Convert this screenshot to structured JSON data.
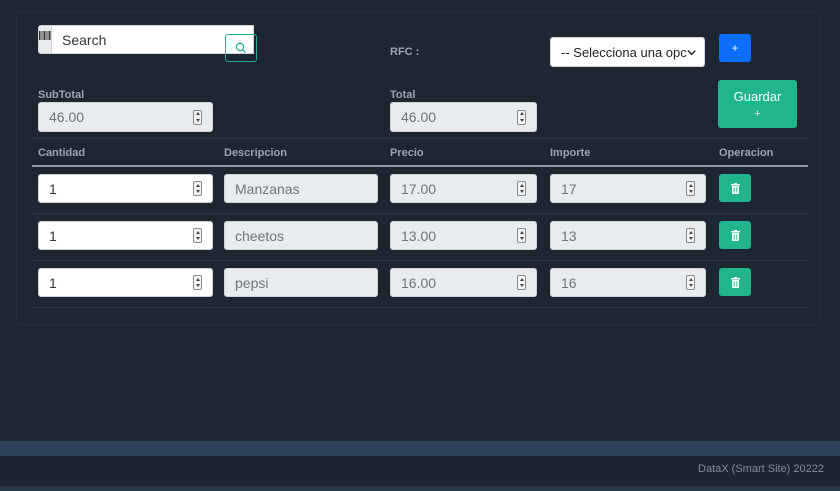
{
  "search": {
    "placeholder": "Search"
  },
  "rfc": {
    "label": "RFC :",
    "select_value": "-- Selecciona una opc"
  },
  "totals": {
    "subtotal_label": "SubTotal",
    "subtotal_value": "46.00",
    "total_label": "Total",
    "total_value": "46.00"
  },
  "buttons": {
    "guardar_label": "Guardar",
    "guardar_plus": "+",
    "add_label": "+"
  },
  "table": {
    "headers": [
      "Cantidad",
      "Descripcion",
      "Precio",
      "Importe",
      "Operacion"
    ],
    "rows": [
      {
        "cantidad": "1",
        "descripcion": "Manzanas",
        "precio": "17.00",
        "importe": "17"
      },
      {
        "cantidad": "1",
        "descripcion": "cheetos",
        "precio": "13.00",
        "importe": "13"
      },
      {
        "cantidad": "1",
        "descripcion": "pepsi",
        "precio": "16.00",
        "importe": "16"
      }
    ]
  },
  "footer": {
    "text": "DataX (Smart Site) 20222"
  },
  "colors": {
    "accent": "#20b58d",
    "primary": "#0d6efd",
    "background": "#1f2732"
  },
  "icons": {
    "barcode": "barcode-icon",
    "search": "search-icon",
    "trash": "trash-icon",
    "chevron": "chevron-down-icon"
  }
}
